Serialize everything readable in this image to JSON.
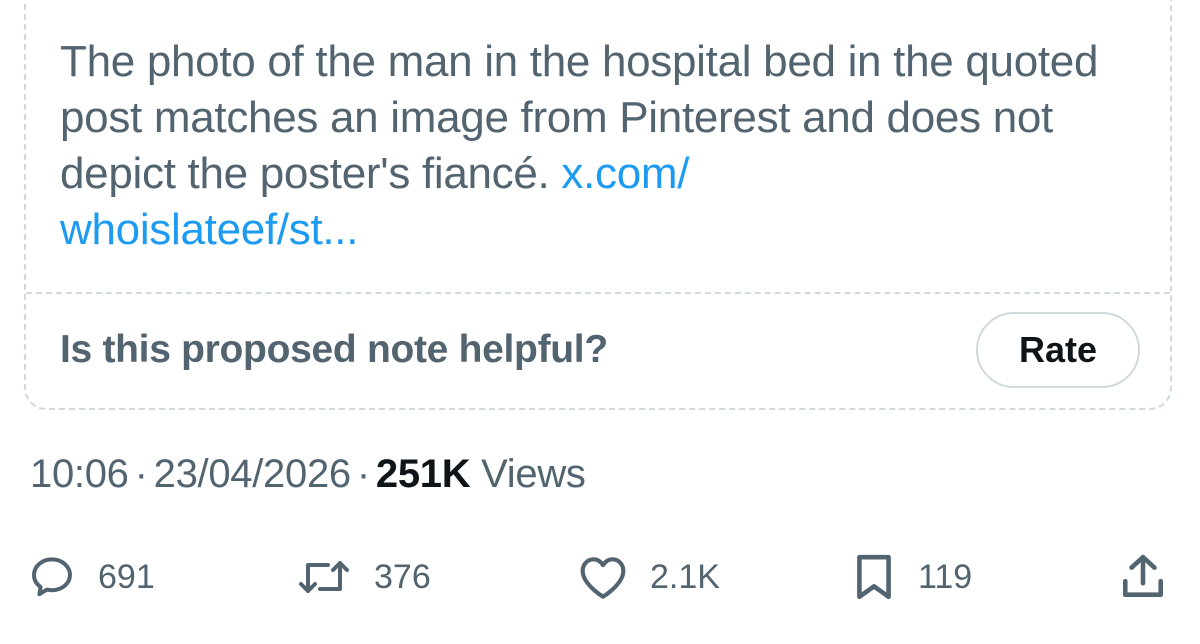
{
  "note": {
    "text": "The photo of the man in the hospital bed in the quoted post matches an image from Pinterest and does not depict the poster's fiancé.",
    "link_line1": "x.com/",
    "link_line2": "whoislateef/st...",
    "prompt": "Is this proposed note helpful?",
    "rate_label": "Rate"
  },
  "meta": {
    "time": "10:06",
    "separator": "·",
    "date": "23/04/2026",
    "views_count": "251K",
    "views_label": "Views"
  },
  "actions": {
    "replies": "691",
    "reposts": "376",
    "likes": "2.1K",
    "bookmarks": "119"
  },
  "icons": {
    "reply": "reply-icon",
    "repost": "repost-icon",
    "like": "heart-icon",
    "bookmark": "bookmark-icon",
    "share": "share-icon"
  },
  "colors": {
    "secondary_text": "#536471",
    "primary_text": "#0f1419",
    "link": "#1d9bf0",
    "border": "#cfd9de"
  }
}
